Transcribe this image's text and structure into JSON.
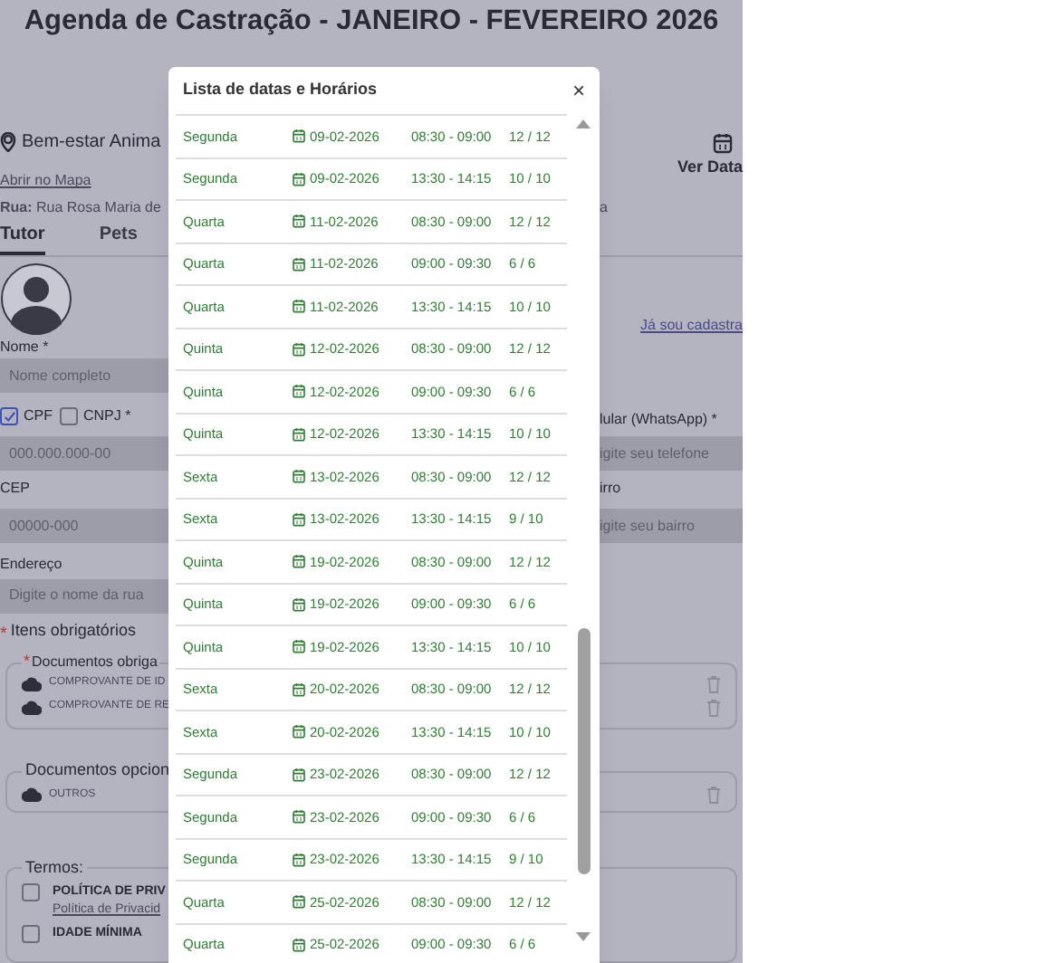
{
  "page_title": "Agenda de Castração - JANEIRO - FEVEREIRO 2026",
  "location": {
    "name": "Bem-estar Anima",
    "map_link": "Abrir no Mapa",
    "address": "**Rua:** Rua Rosa Maria de",
    "address_tail": "a",
    "dates_button": "Ver Data"
  },
  "tabs": [
    {
      "label": "Tutor",
      "selected": true
    },
    {
      "label": "Pets",
      "selected": false
    }
  ],
  "login_link": "Já sou cadastra",
  "form": {
    "name_label": "Nome *",
    "name_placeholder": "Nome completo",
    "doc_types": [
      {
        "label": "CPF",
        "checked": true
      },
      {
        "label": "CNPJ *",
        "checked": false
      }
    ],
    "doc_placeholder": "000.000.000-00",
    "phone_label": "lular (WhatsApp) *",
    "phone_placeholder": "igite seu telefone",
    "cep_label": "CEP",
    "cep_placeholder": "00000-000",
    "district_label": "irro",
    "district_placeholder": "igite seu bairro",
    "street_label": "Endereço",
    "street_placeholder": "Digite o nome da rua"
  },
  "required_mark": "*",
  "required_note": "Itens obrigatórios",
  "required_docs": {
    "mark": "*",
    "legend": "Documentos obriga",
    "items": [
      "COMPROVANTE DE ID",
      "COMPROVANTE DE RE"
    ]
  },
  "optional_docs": {
    "legend": "Documentos opcion",
    "items": [
      "OUTROS"
    ]
  },
  "terms": {
    "legend": "Termos:",
    "items": [
      {
        "title": "POLÍTICA DE PRIV",
        "link": "Política de Privacid",
        "checked": false
      },
      {
        "title": "IDADE MÍNIMA",
        "checked": false
      }
    ]
  },
  "modal": {
    "title": "Lista de datas e Horários",
    "close": "×",
    "rows": [
      {
        "day": "Segunda",
        "date": "09-02-2026",
        "time": "08:30 - 09:00",
        "slots": "12 / 12"
      },
      {
        "day": "Segunda",
        "date": "09-02-2026",
        "time": "13:30 - 14:15",
        "slots": "10 / 10"
      },
      {
        "day": "Quarta",
        "date": "11-02-2026",
        "time": "08:30 - 09:00",
        "slots": "12 / 12"
      },
      {
        "day": "Quarta",
        "date": "11-02-2026",
        "time": "09:00 - 09:30",
        "slots": "6 / 6"
      },
      {
        "day": "Quarta",
        "date": "11-02-2026",
        "time": "13:30 - 14:15",
        "slots": "10 / 10"
      },
      {
        "day": "Quinta",
        "date": "12-02-2026",
        "time": "08:30 - 09:00",
        "slots": "12 / 12"
      },
      {
        "day": "Quinta",
        "date": "12-02-2026",
        "time": "09:00 - 09:30",
        "slots": "6 / 6"
      },
      {
        "day": "Quinta",
        "date": "12-02-2026",
        "time": "13:30 - 14:15",
        "slots": "10 / 10"
      },
      {
        "day": "Sexta",
        "date": "13-02-2026",
        "time": "08:30 - 09:00",
        "slots": "12 / 12"
      },
      {
        "day": "Sexta",
        "date": "13-02-2026",
        "time": "13:30 - 14:15",
        "slots": "9 / 10"
      },
      {
        "day": "Quinta",
        "date": "19-02-2026",
        "time": "08:30 - 09:00",
        "slots": "12 / 12"
      },
      {
        "day": "Quinta",
        "date": "19-02-2026",
        "time": "09:00 - 09:30",
        "slots": "6 / 6"
      },
      {
        "day": "Quinta",
        "date": "19-02-2026",
        "time": "13:30 - 14:15",
        "slots": "10 / 10"
      },
      {
        "day": "Sexta",
        "date": "20-02-2026",
        "time": "08:30 - 09:00",
        "slots": "12 / 12"
      },
      {
        "day": "Sexta",
        "date": "20-02-2026",
        "time": "13:30 - 14:15",
        "slots": "10 / 10"
      },
      {
        "day": "Segunda",
        "date": "23-02-2026",
        "time": "08:30 - 09:00",
        "slots": "12 / 12"
      },
      {
        "day": "Segunda",
        "date": "23-02-2026",
        "time": "09:00 - 09:30",
        "slots": "6 / 6"
      },
      {
        "day": "Segunda",
        "date": "23-02-2026",
        "time": "13:30 - 14:15",
        "slots": "9 / 10"
      },
      {
        "day": "Quarta",
        "date": "25-02-2026",
        "time": "08:30 - 09:00",
        "slots": "12 / 12"
      },
      {
        "day": "Quarta",
        "date": "25-02-2026",
        "time": "09:00 - 09:30",
        "slots": "6 / 6"
      }
    ]
  }
}
